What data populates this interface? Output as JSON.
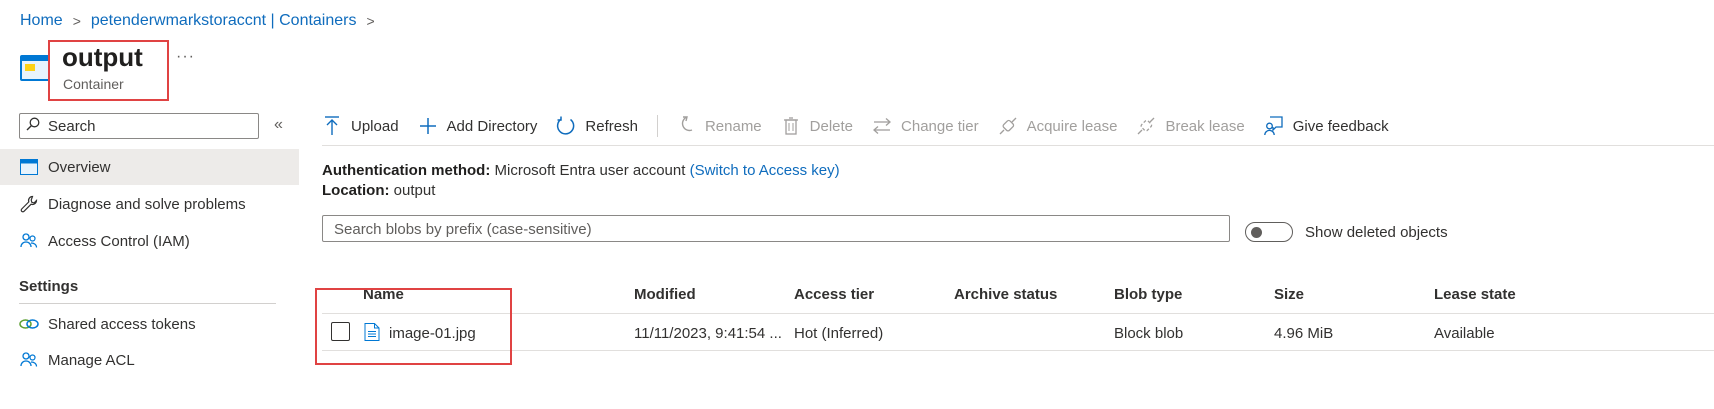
{
  "breadcrumb": {
    "items": [
      {
        "label": "Home"
      },
      {
        "label": "petenderwmarkstoraccnt | Containers"
      }
    ],
    "separator": ">"
  },
  "header": {
    "title": "output",
    "subtitle": "Container",
    "more": "···",
    "icon": "container-icon"
  },
  "sidebar": {
    "search_placeholder": "Search",
    "collapse_label": "«",
    "items": [
      {
        "label": "Overview",
        "icon": "overview-icon",
        "active": true
      },
      {
        "label": "Diagnose and solve problems",
        "icon": "wrench-icon"
      },
      {
        "label": "Access Control (IAM)",
        "icon": "people-icon"
      }
    ],
    "settings_title": "Settings",
    "settings_items": [
      {
        "label": "Shared access tokens",
        "icon": "link-icon"
      },
      {
        "label": "Manage ACL",
        "icon": "people-icon"
      }
    ]
  },
  "toolbar": {
    "upload": "Upload",
    "add_directory": "Add Directory",
    "refresh": "Refresh",
    "rename": "Rename",
    "delete": "Delete",
    "change_tier": "Change tier",
    "acquire_lease": "Acquire lease",
    "break_lease": "Break lease",
    "give_feedback": "Give feedback"
  },
  "info": {
    "auth_label": "Authentication method:",
    "auth_value": "Microsoft Entra user account",
    "auth_link": "(Switch to Access key)",
    "location_label": "Location:",
    "location_value": "output"
  },
  "blob_search": {
    "placeholder": "Search blobs by prefix (case-sensitive)"
  },
  "show_deleted": {
    "label": "Show deleted objects",
    "on": false
  },
  "table": {
    "columns": [
      "Name",
      "Modified",
      "Access tier",
      "Archive status",
      "Blob type",
      "Size",
      "Lease state"
    ],
    "rows": [
      {
        "name": "image-01.jpg",
        "modified": "11/11/2023, 9:41:54 ...",
        "access_tier": "Hot (Inferred)",
        "archive_status": "",
        "blob_type": "Block blob",
        "size": "4.96 MiB",
        "lease_state": "Available"
      }
    ]
  },
  "colors": {
    "accent": "#0f6cbd",
    "highlight": "#e04343",
    "text": "#323130",
    "disabled": "#a19f9d"
  }
}
